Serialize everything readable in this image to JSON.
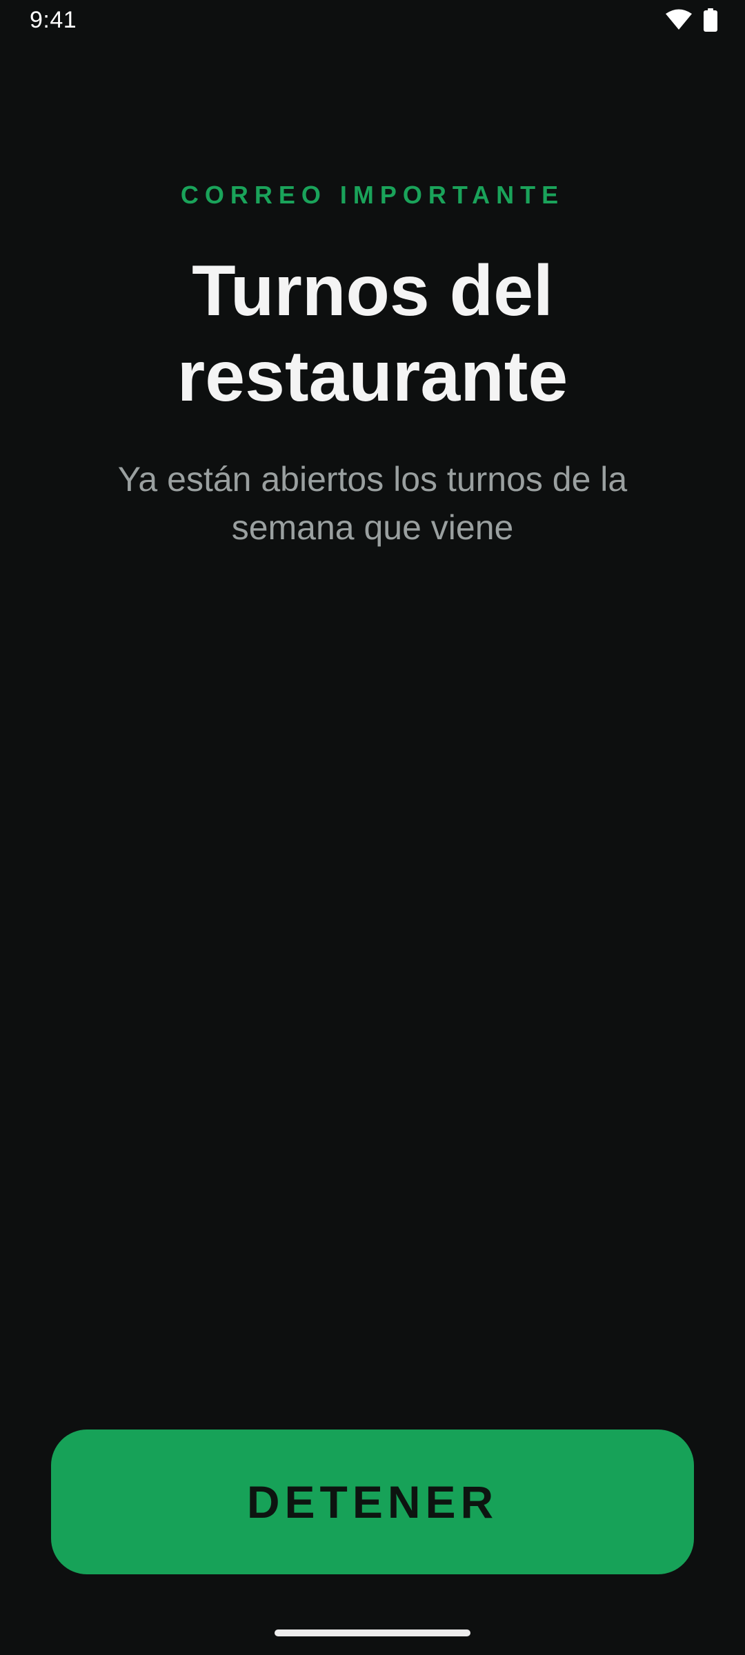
{
  "status_bar": {
    "time": "9:41",
    "icons": [
      "wifi-icon",
      "battery-icon"
    ]
  },
  "alarm": {
    "eyebrow": "CORREO IMPORTANTE",
    "title": "Turnos del restaurante",
    "subtitle": "Ya están abiertos los turnos de la semana que viene",
    "stop_label": "DETENER"
  },
  "colors": {
    "background": "#0d0f0f",
    "accent": "#17a258",
    "title": "#f4f4f4",
    "subtitle": "#9aa0a0"
  }
}
